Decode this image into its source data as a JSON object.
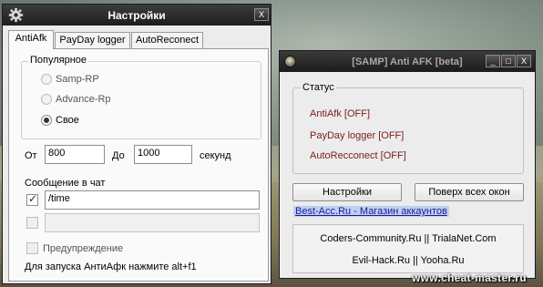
{
  "settings_window": {
    "title": "Настройки",
    "close_glyph": "X",
    "tabs": [
      "AntiAfk",
      "PayDay logger",
      "AutoReconect"
    ],
    "popular_group": {
      "legend": "Популярное",
      "options": [
        "Samp-RP",
        "Advance-Rp",
        "Свое"
      ],
      "selected": "Свое"
    },
    "from_label": "От",
    "from_value": "800",
    "to_label": "До",
    "to_value": "1000",
    "seconds_label": "секунд",
    "chat_message_label": "Сообщение в чат",
    "chat_checkbox_checked": true,
    "chat_message_value": "/time",
    "second_checkbox_checked": false,
    "second_message_value": "",
    "warning_label": "Предупреждение",
    "warning_checked": false,
    "hint": "Для запуска АнтиАфк нажмите alt+f1"
  },
  "afk_window": {
    "title": "[SAMP] Anti AFK [beta]",
    "min_glyph": "_",
    "max_glyph": "□",
    "close_glyph": "X",
    "status": {
      "legend": "Статус",
      "lines": [
        "AntiAfk [OFF]",
        "PayDay logger [OFF]",
        "AutoRecconect [OFF]"
      ],
      "color": "#7a1c1c"
    },
    "settings_button": "Настройки",
    "topmost_button": "Поверх всех окон",
    "link": "Best-Acc.Ru - Магазин аккаунтов",
    "credits": [
      "Coders-Community.Ru || TrialaNet.Com",
      "Evil-Hack.Ru || Yooha.Ru"
    ]
  },
  "watermark": "www.cheat-master.ru",
  "icons": {
    "settings_window": "gear-icon",
    "afk_window": "app-icon",
    "checkbox_tick": "check-icon"
  },
  "colors": {
    "titlebar": "#1e1e1e",
    "window_bg": "#ececec",
    "status_text": "#7a1c1c",
    "link_text": "#1a1a9a",
    "link_highlight": "#bfd0ef"
  }
}
